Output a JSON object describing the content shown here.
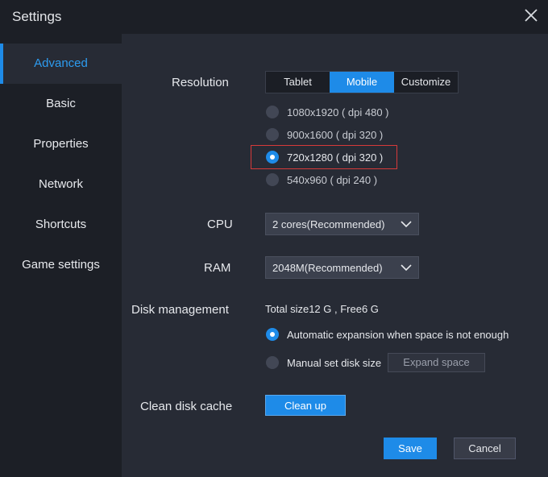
{
  "window": {
    "title": "Settings"
  },
  "sidebar": {
    "items": [
      {
        "label": "Advanced"
      },
      {
        "label": "Basic"
      },
      {
        "label": "Properties"
      },
      {
        "label": "Network"
      },
      {
        "label": "Shortcuts"
      },
      {
        "label": "Game settings"
      }
    ],
    "active_index": 0
  },
  "resolution": {
    "label": "Resolution",
    "tabs": [
      {
        "label": "Tablet"
      },
      {
        "label": "Mobile"
      },
      {
        "label": "Customize"
      }
    ],
    "selected_tab": "Mobile",
    "options": [
      {
        "label": "1080x1920 ( dpi 480 )"
      },
      {
        "label": "900x1600 ( dpi 320 )"
      },
      {
        "label": "720x1280 ( dpi 320 )"
      },
      {
        "label": "540x960 ( dpi 240 )"
      }
    ],
    "selected_option": "720x1280 ( dpi 320 )"
  },
  "cpu": {
    "label": "CPU",
    "value": "2 cores(Recommended)"
  },
  "ram": {
    "label": "RAM",
    "value": "2048M(Recommended)"
  },
  "disk": {
    "label": "Disk management",
    "summary": "Total size12 G , Free6 G",
    "auto_label": "Automatic expansion when space is not enough",
    "manual_label": "Manual set disk size",
    "expand_button": "Expand space",
    "mode": "auto"
  },
  "cache": {
    "label": "Clean disk cache",
    "button": "Clean up"
  },
  "footer": {
    "save": "Save",
    "cancel": "Cancel"
  },
  "colors": {
    "accent": "#1e8be8",
    "highlight_border": "#d63a3a",
    "panel_bg": "#272b35",
    "window_bg": "#1c1f26"
  }
}
